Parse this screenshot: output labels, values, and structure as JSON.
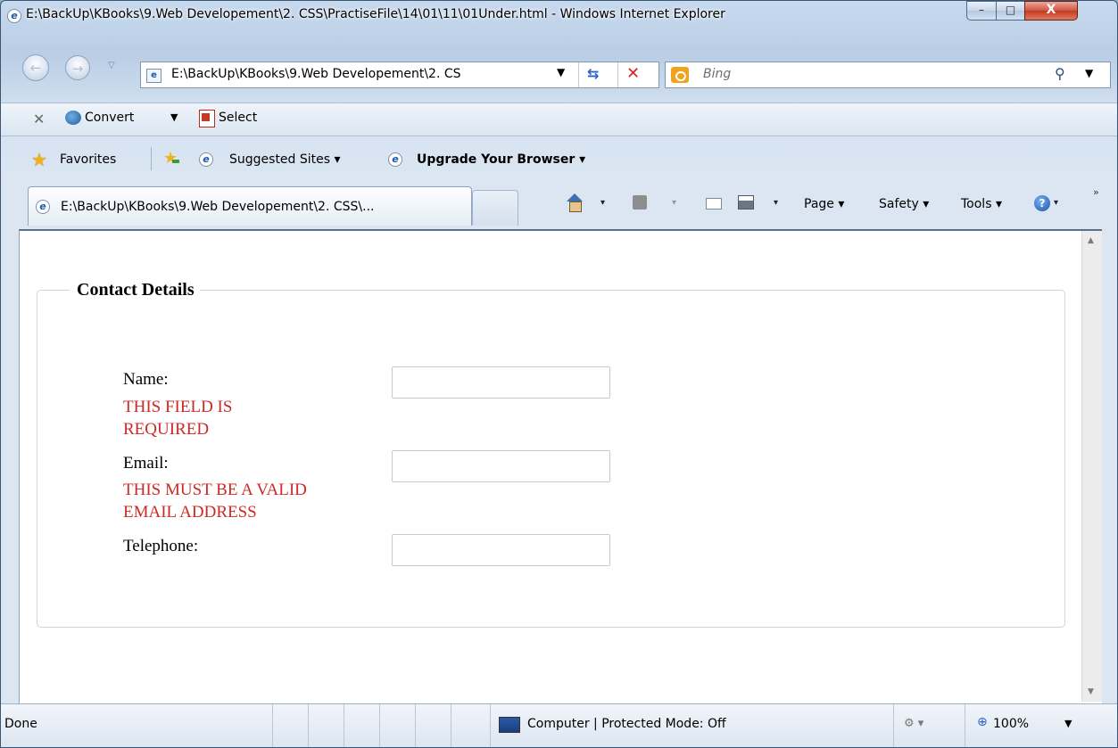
{
  "window": {
    "title": "E:\\BackUp\\KBooks\\9.Web Developement\\2. CSS\\PractiseFile\\14\\01\\11\\01Under.html - Windows Internet Explorer",
    "min_glyph": "–",
    "max_glyph": "□",
    "close_glyph": "X"
  },
  "nav": {
    "back_glyph": "←",
    "forward_glyph": "→",
    "history_glyph": "▽",
    "address_url": "E:\\BackUp\\KBooks\\9.Web Developement\\2. CS",
    "address_dd": "▼",
    "refresh_glyph": "⇆",
    "stop_glyph": "✕",
    "search_placeholder": "Bing",
    "search_glyph": "⚲",
    "search_dd": "▼"
  },
  "command_toolbar": {
    "close_glyph": "✕",
    "convert_label": "Convert",
    "convert_dd": "▼",
    "select_label": "Select"
  },
  "favorites_bar": {
    "favorites_label": "Favorites",
    "star_glyph": "★",
    "suggested_label": "Suggested Sites ▾",
    "upgrade_label": "Upgrade Your Browser ▾",
    "e_glyph": "e"
  },
  "tabs": {
    "active_tab_label": "E:\\BackUp\\KBooks\\9.Web Developement\\2. CSS\\..."
  },
  "command_bar": {
    "page_label": "Page ▾",
    "safety_label": "Safety ▾",
    "tools_label": "Tools ▾",
    "help_glyph": "?",
    "help_dd": "▾",
    "dd": "▾",
    "chevron": "»"
  },
  "form": {
    "legend": "Contact Details",
    "name_label": "Name:",
    "name_error_1": "THIS FIELD IS",
    "name_error_2": "REQUIRED",
    "email_label": "Email:",
    "email_error_1": "THIS MUST BE A VALID",
    "email_error_2": "EMAIL ADDRESS",
    "telephone_label": "Telephone:"
  },
  "scrollbar": {
    "up_glyph": "▲",
    "down_glyph": "▼"
  },
  "status_bar": {
    "status_text": "Done",
    "zone_text": "Computer | Protected Mode: Off",
    "zone_icon_glyph": "⚙ ▾",
    "zoom_glyph": "⊕",
    "zoom_text": "100%",
    "zoom_dd": "▼"
  }
}
